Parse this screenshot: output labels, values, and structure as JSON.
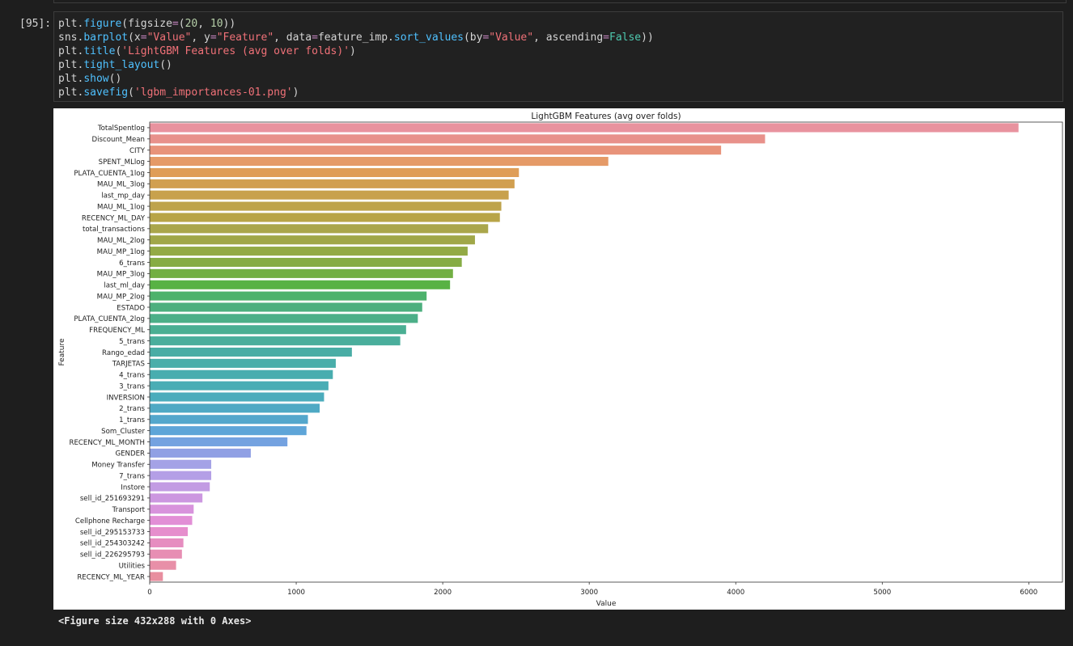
{
  "cell": {
    "prompt": "[95]:",
    "code_lines": [
      [
        [
          "plt.",
          ""
        ],
        [
          "figure",
          "fn"
        ],
        [
          "(figsize",
          ""
        ],
        [
          "=",
          "eq"
        ],
        [
          "(",
          ""
        ],
        [
          "20",
          "num"
        ],
        [
          ", ",
          ""
        ],
        [
          "10",
          "num"
        ],
        [
          "))",
          ""
        ]
      ],
      [
        [
          "sns.",
          ""
        ],
        [
          "barplot",
          "fn"
        ],
        [
          "(x",
          ""
        ],
        [
          "=",
          "eq"
        ],
        [
          "\"Value\"",
          "str"
        ],
        [
          ", y",
          ""
        ],
        [
          "=",
          "eq"
        ],
        [
          "\"Feature\"",
          "str"
        ],
        [
          ", data",
          ""
        ],
        [
          "=",
          "eq"
        ],
        [
          "feature_imp.",
          ""
        ],
        [
          "sort_values",
          "fn"
        ],
        [
          "(by",
          ""
        ],
        [
          "=",
          "eq"
        ],
        [
          "\"Value\"",
          "str"
        ],
        [
          ", ascending",
          ""
        ],
        [
          "=",
          "eq"
        ],
        [
          "False",
          "bool"
        ],
        [
          "))",
          ""
        ]
      ],
      [
        [
          "plt.",
          ""
        ],
        [
          "title",
          "fn"
        ],
        [
          "(",
          ""
        ],
        [
          "'LightGBM Features (avg over folds)'",
          "str"
        ],
        [
          ")",
          ""
        ]
      ],
      [
        [
          "plt.",
          ""
        ],
        [
          "tight_layout",
          "fn"
        ],
        [
          "()",
          ""
        ]
      ],
      [
        [
          "plt.",
          ""
        ],
        [
          "show",
          "fn"
        ],
        [
          "()",
          ""
        ]
      ],
      [
        [
          "plt.",
          ""
        ],
        [
          "savefig",
          "fn"
        ],
        [
          "(",
          ""
        ],
        [
          "'lgbm_importances-01.png'",
          "str"
        ],
        [
          ")",
          ""
        ]
      ]
    ]
  },
  "output_text": "<Figure size 432x288 with 0 Axes>",
  "colors": {
    "str": "#f07178",
    "fn": "#4fc1ff",
    "num": "#b5cea8",
    "eq": "#c586c0",
    "bool": "#4ec9b0"
  },
  "chart_data": {
    "type": "bar",
    "orientation": "horizontal",
    "title": "LightGBM Features (avg over folds)",
    "xlabel": "Value",
    "ylabel": "Feature",
    "xlim": [
      0,
      6230
    ],
    "xticks": [
      0,
      1000,
      2000,
      3000,
      4000,
      5000,
      6000
    ],
    "grid": false,
    "categories": [
      "TotalSpentlog",
      "Discount_Mean",
      "CITY",
      "SPENT_MLlog",
      "PLATA_CUENTA_1log",
      "MAU_ML_3log",
      "last_mp_day",
      "MAU_ML_1log",
      "RECENCY_ML_DAY",
      "total_transactions",
      "MAU_ML_2log",
      "MAU_MP_1log",
      "6_trans",
      "MAU_MP_3log",
      "last_ml_day",
      "MAU_MP_2log",
      "ESTADO",
      "PLATA_CUENTA_2log",
      "FREQUENCY_ML",
      "5_trans",
      "Rango_edad",
      "TARJETAS",
      "4_trans",
      "3_trans",
      "INVERSION",
      "2_trans",
      "1_trans",
      "Som_Cluster",
      "RECENCY_ML_MONTH",
      "GENDER",
      "Money Transfer",
      "7_trans",
      "Instore",
      "sell_id_251693291",
      "Transport",
      "Cellphone Recharge",
      "sell_id_295153733",
      "sell_id_254303242",
      "sell_id_226295793",
      "Utilities",
      "RECENCY_ML_YEAR"
    ],
    "values": [
      5930,
      4200,
      3900,
      3130,
      2520,
      2490,
      2450,
      2400,
      2390,
      2310,
      2220,
      2170,
      2130,
      2070,
      2050,
      1890,
      1860,
      1830,
      1750,
      1710,
      1380,
      1270,
      1250,
      1220,
      1190,
      1160,
      1080,
      1070,
      940,
      690,
      420,
      420,
      410,
      360,
      300,
      290,
      260,
      230,
      220,
      180,
      90
    ],
    "colors": [
      "#e8929e",
      "#e8918b",
      "#e8937a",
      "#e59a67",
      "#df9d57",
      "#d19f50",
      "#c8a14c",
      "#bea34b",
      "#b8a447",
      "#aaa64b",
      "#a0a748",
      "#93aa45",
      "#86ac44",
      "#72af43",
      "#58b244",
      "#4db26c",
      "#4caf7e",
      "#4caf88",
      "#4aaf93",
      "#4aae9c",
      "#49ada5",
      "#49aeaa",
      "#48adaf",
      "#4aadb5",
      "#4bacbc",
      "#4ea9c4",
      "#53a7cc",
      "#5ea5d8",
      "#74a2e0",
      "#90a0e4",
      "#a4a2e6",
      "#b49fe6",
      "#c29be3",
      "#cc97e0",
      "#d893dc",
      "#e28fd6",
      "#e68ecd",
      "#e68dc0",
      "#e78eb3",
      "#e88fa8",
      "#e88e9f"
    ]
  }
}
